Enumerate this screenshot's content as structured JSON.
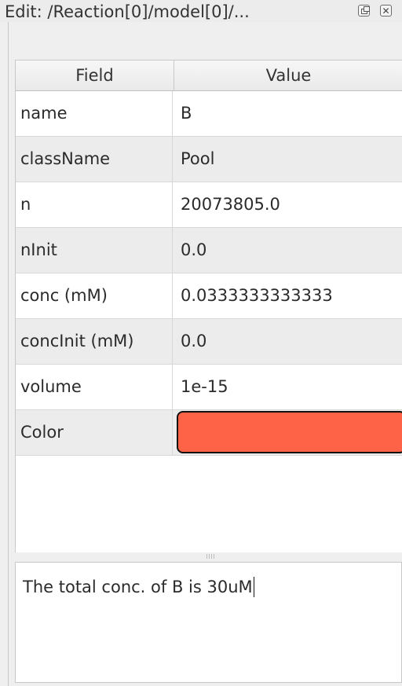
{
  "window": {
    "title": "Edit: /Reaction[0]/model[0]/...",
    "float_icon": "float-icon",
    "close_icon": "close-icon"
  },
  "table": {
    "headers": {
      "field": "Field",
      "value": "Value"
    },
    "rows": [
      {
        "field": "name",
        "value": "B"
      },
      {
        "field": "className",
        "value": "Pool"
      },
      {
        "field": "n",
        "value": "20073805.0"
      },
      {
        "field": "nInit",
        "value": "0.0"
      },
      {
        "field": "conc (mM)",
        "value": "0.0333333333333"
      },
      {
        "field": "concInit (mM)",
        "value": "0.0"
      },
      {
        "field": "volume",
        "value": "1e-15"
      },
      {
        "field": "Color",
        "value": ""
      }
    ],
    "color_value": "#ff6347"
  },
  "notes": {
    "text": "The total conc. of B is 30uM"
  }
}
